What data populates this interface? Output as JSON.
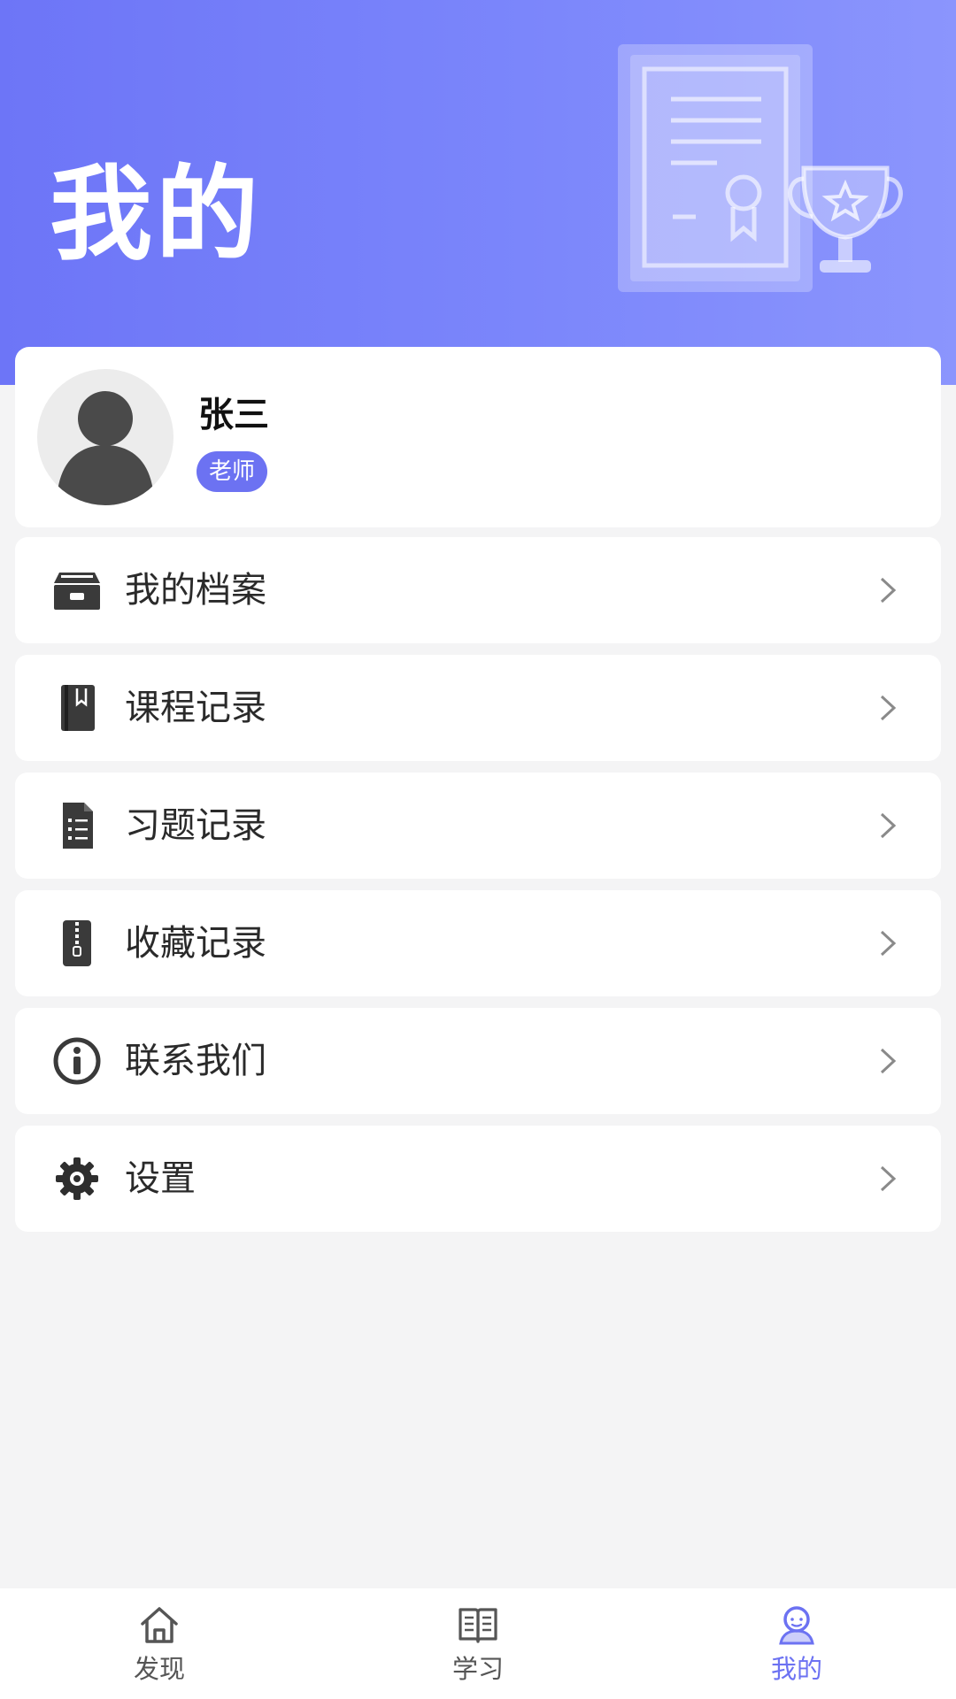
{
  "header": {
    "title": "我的"
  },
  "profile": {
    "name": "张三",
    "role": "老师"
  },
  "menu": {
    "items": [
      {
        "label": "我的档案",
        "icon": "archive-box-icon"
      },
      {
        "label": "课程记录",
        "icon": "book-icon"
      },
      {
        "label": "习题记录",
        "icon": "document-list-icon"
      },
      {
        "label": "收藏记录",
        "icon": "zip-file-icon"
      },
      {
        "label": "联系我们",
        "icon": "info-icon"
      },
      {
        "label": "设置",
        "icon": "gear-icon"
      }
    ]
  },
  "tabbar": {
    "tabs": [
      {
        "label": "发现",
        "icon": "home-icon",
        "active": false
      },
      {
        "label": "学习",
        "icon": "open-book-icon",
        "active": false
      },
      {
        "label": "我的",
        "icon": "user-icon",
        "active": true
      }
    ]
  },
  "colors": {
    "accent": "#6c72f2",
    "header_start": "#6d75f7",
    "header_end": "#8b95fd",
    "background": "#f4f4f5"
  }
}
